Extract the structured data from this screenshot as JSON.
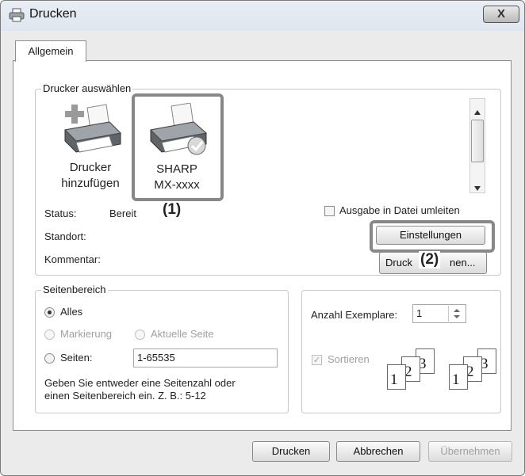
{
  "window": {
    "title": "Drucken",
    "close_symbol": "X"
  },
  "tabs": [
    {
      "label": "Allgemein"
    }
  ],
  "printer_group": {
    "legend": "Drucker auswählen",
    "printers": [
      {
        "line1": "Drucker",
        "line2": "hinzufügen",
        "icon": "add-printer-icon"
      },
      {
        "line1": "SHARP",
        "line2": "MX-xxxx",
        "icon": "printer-default-icon",
        "selected": true
      }
    ],
    "callout_printer": "(1)",
    "status_label": "Status:",
    "status_value": "Bereit",
    "location_label": "Standort:",
    "comment_label": "Kommentar:",
    "print_to_file_label": "Ausgabe in Datei umleiten",
    "settings_button": "Einstellungen",
    "callout_settings": "(2)",
    "find_printer_left": "Druck",
    "find_printer_right": "nen..."
  },
  "page_range": {
    "legend": "Seitenbereich",
    "all_label": "Alles",
    "selection_label": "Markierung",
    "current_page_label": "Aktuelle Seite",
    "pages_label": "Seiten:",
    "pages_value": "1-65535",
    "hint_line1": "Geben Sie entweder eine Seitenzahl oder",
    "hint_line2": "einen Seitenbereich ein. Z. B.: 5-12"
  },
  "copies": {
    "label": "Anzahl Exemplare:",
    "value": "1",
    "collate_label": "Sortieren",
    "collate_pages": [
      "1",
      "2",
      "3"
    ]
  },
  "footer": {
    "print_button": "Drucken",
    "cancel_button": "Abbrechen",
    "apply_button": "Übernehmen"
  },
  "colors": {
    "highlight": "#888888",
    "disabled_text": "#a0a0a0"
  }
}
